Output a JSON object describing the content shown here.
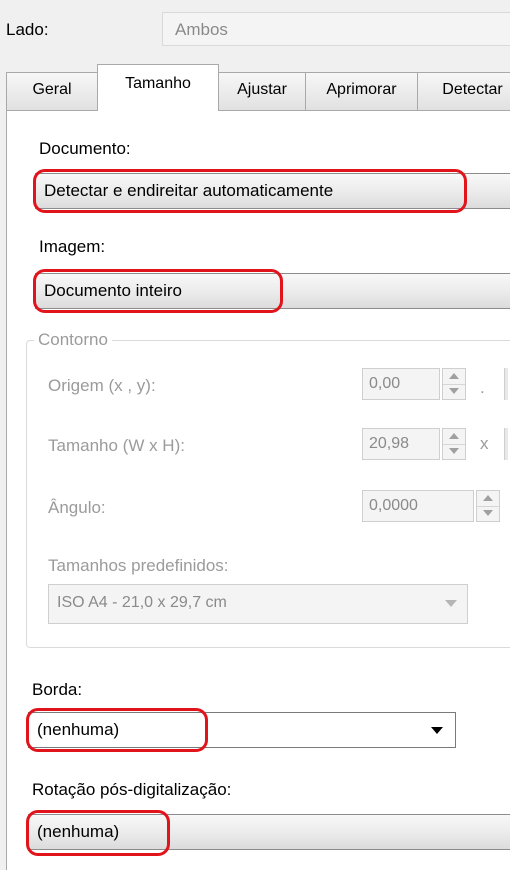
{
  "top": {
    "lado_label": "Lado:",
    "lado_value": "Ambos"
  },
  "tabs": [
    {
      "label": "Geral",
      "active": false
    },
    {
      "label": "Tamanho",
      "active": true
    },
    {
      "label": "Ajustar",
      "active": false
    },
    {
      "label": "Aprimorar",
      "active": false
    },
    {
      "label": "Detectar",
      "active": false
    }
  ],
  "documento": {
    "label": "Documento:",
    "value": "Detectar e endireitar automaticamente"
  },
  "imagem": {
    "label": "Imagem:",
    "value": "Documento inteiro"
  },
  "contorno": {
    "legend": "Contorno",
    "origem": {
      "label": "Origem (x , y):",
      "value": "0,00",
      "separator": "."
    },
    "tamanho": {
      "label": "Tamanho (W x H):",
      "value": "20,98",
      "separator": "x"
    },
    "angulo": {
      "label": "Ângulo:",
      "value": "0,0000"
    },
    "presets": {
      "label": "Tamanhos predefinidos:",
      "value": "ISO A4 - 21,0 x 29,7 cm"
    }
  },
  "borda": {
    "label": "Borda:",
    "value": "(nenhuma)"
  },
  "rotacao": {
    "label": "Rotação pós-digitalização:",
    "value": "(nenhuma)"
  },
  "colors": {
    "highlight": "#e1141c",
    "disabled_text": "#9b9b9b",
    "panel_bg": "#ffffff",
    "window_bg": "#f0f0f0"
  },
  "icons": {
    "spin_up": "triangle-up-icon",
    "spin_down": "triangle-down-icon",
    "dropdown": "dropdown-arrow-icon"
  }
}
